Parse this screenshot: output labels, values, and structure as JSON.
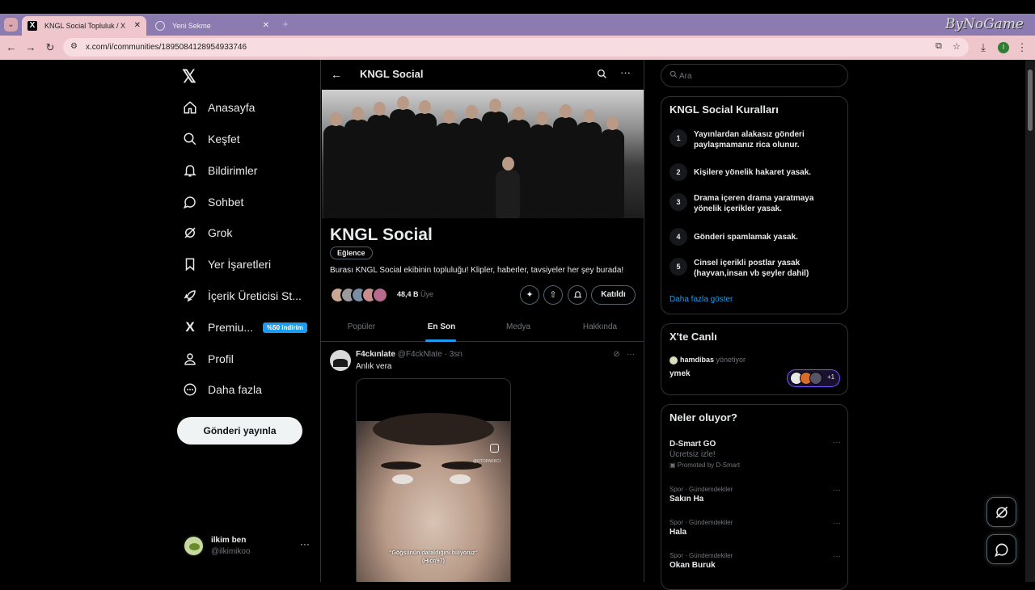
{
  "browser": {
    "tabs": [
      {
        "title": "KNGL Social Topluluk / X"
      },
      {
        "title": "Yeni Sekme"
      }
    ],
    "url": "x.com/i/communities/1895084128954933746",
    "watermark": "ByNoGame",
    "profile_initial": "I"
  },
  "sidebar": {
    "items": [
      {
        "label": "Anasayfa",
        "icon": "home-icon"
      },
      {
        "label": "Keşfet",
        "icon": "search-icon"
      },
      {
        "label": "Bildirimler",
        "icon": "bell-icon"
      },
      {
        "label": "Sohbet",
        "icon": "chat-icon"
      },
      {
        "label": "Grok",
        "icon": "grok-icon"
      },
      {
        "label": "Yer İşaretleri",
        "icon": "bookmark-icon"
      },
      {
        "label": "İçerik Üreticisi St...",
        "icon": "rocket-icon"
      },
      {
        "label": "Premiu...",
        "icon": "x-premium-icon",
        "badge": "%50 indirim"
      },
      {
        "label": "Profil",
        "icon": "person-icon"
      },
      {
        "label": "Daha fazla",
        "icon": "more-circle-icon"
      }
    ],
    "post_button": "Gönderi yayınla",
    "user": {
      "name": "ilkim ben",
      "handle": "@ilkimikoo"
    }
  },
  "community": {
    "header_title": "KNGL Social",
    "name": "KNGL Social",
    "category": "Eğlence",
    "description": "Burası KNGL Social ekibinin topluluğu! Klipler, haberler, tavsiyeler her şey burada!",
    "member_count": "48,4 B",
    "member_label": "Üye",
    "joined_label": "Katıldı",
    "tabs": [
      {
        "label": "Popüler"
      },
      {
        "label": "En Son"
      },
      {
        "label": "Medya"
      },
      {
        "label": "Hakkında"
      }
    ],
    "active_tab": "En Son"
  },
  "post": {
    "author_name": "F4ckınlate",
    "author_handle": "@F4ckNlate",
    "time": "· 3sn",
    "text": "Anlık vera",
    "media_caption_line1": "\"Göğsünün daraldığını biliyoruz\"",
    "media_caption_line2": "(Hicr/97)",
    "media_watermark": "@OTOPARKCI"
  },
  "right": {
    "search_placeholder": "Ara",
    "rules_title": "KNGL Social Kuralları",
    "rules": [
      {
        "num": "1",
        "text": "Yayınlardan alakasız gönderi paylaşmamanız rica olunur."
      },
      {
        "num": "2",
        "text": "Kişilere yönelik hakaret yasak."
      },
      {
        "num": "3",
        "text": "Drama içeren drama yaratmaya yönelik içerikler yasak."
      },
      {
        "num": "4",
        "text": "Gönderi spamlamak yasak."
      },
      {
        "num": "5",
        "text": "Cinsel içerikli postlar yasak (hayvan,insan vb şeyler dahil)"
      }
    ],
    "rules_more": "Daha fazla göster",
    "live_title": "X'te Canlı",
    "live_host": "hamdibas",
    "live_host_role": "yönetiyor",
    "live_space_title": "ymek",
    "live_listener_extra": "+1",
    "trends_title": "Neler oluyor?",
    "trends": [
      {
        "meta": "",
        "name": "D-Smart GO",
        "sub": "Ücretsiz izle!",
        "promo": "Promoted by D-Smart"
      },
      {
        "meta": "Spor · Gündemdekiler",
        "name": "Sakın Ha",
        "sub": "",
        "promo": ""
      },
      {
        "meta": "Spor · Gündemdekiler",
        "name": "Hala",
        "sub": "",
        "promo": ""
      },
      {
        "meta": "Spor · Gündemdekiler",
        "name": "Okan Buruk",
        "sub": "",
        "promo": ""
      }
    ]
  },
  "colors": {
    "accent": "#1d9bf0",
    "background": "#000000",
    "border": "#2f3336",
    "tabbar": "#8b7bb0",
    "addressbar": "#f0c6cd"
  }
}
